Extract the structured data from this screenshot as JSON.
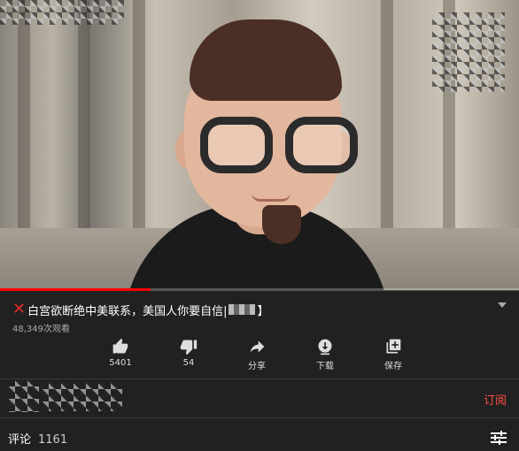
{
  "video": {
    "title": "白宫欲断绝中美联系，美国人你要自信|",
    "title_suffix": "】",
    "views": "48,349次观看",
    "progress": 0.29
  },
  "actions": [
    {
      "icon": "thumbs-up-icon",
      "label": "5401"
    },
    {
      "icon": "thumbs-down-icon",
      "label": "54"
    },
    {
      "icon": "share-icon",
      "label": "分享"
    },
    {
      "icon": "download-icon",
      "label": "下载"
    },
    {
      "icon": "save-playlist-icon",
      "label": "保存"
    }
  ],
  "channel": {
    "subscribe_label": "订阅"
  },
  "comments": {
    "label": "评论",
    "count": "1161"
  },
  "colors": {
    "background": "#212121",
    "accent": "#ff0000",
    "subscribe": "#ff4e45",
    "title_mark": "#e32a2a"
  }
}
